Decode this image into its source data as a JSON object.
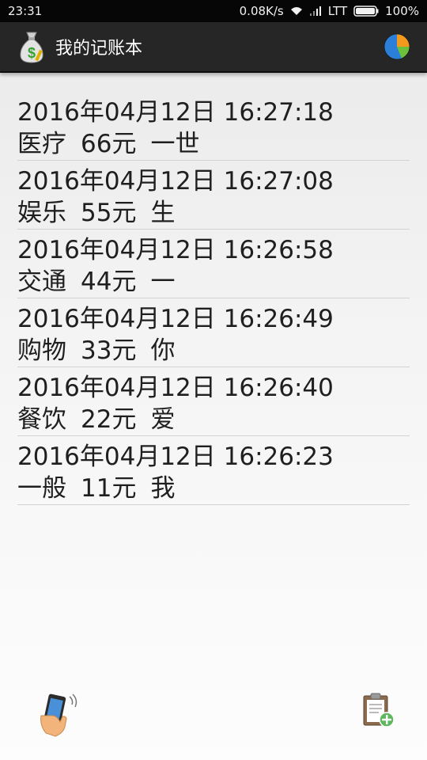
{
  "status_bar": {
    "time": "23:31",
    "speed": "0.08K/s",
    "network": "LTT",
    "battery": "100%"
  },
  "app_bar": {
    "title": "我的记账本",
    "app_icon": "money-bag-icon",
    "chart_icon": "pie-chart-icon"
  },
  "records": [
    {
      "datetime": "2016年04月12日 16:27:18",
      "category": "医疗",
      "amount": "66元",
      "note": "一世"
    },
    {
      "datetime": "2016年04月12日 16:27:08",
      "category": "娱乐",
      "amount": "55元",
      "note": "生"
    },
    {
      "datetime": "2016年04月12日 16:26:58",
      "category": "交通",
      "amount": "44元",
      "note": "一"
    },
    {
      "datetime": "2016年04月12日 16:26:49",
      "category": "购物",
      "amount": "33元",
      "note": "你"
    },
    {
      "datetime": "2016年04月12日 16:26:40",
      "category": "餐饮",
      "amount": "22元",
      "note": "爱"
    },
    {
      "datetime": "2016年04月12日 16:26:23",
      "category": "一般",
      "amount": "11元",
      "note": "我"
    }
  ],
  "bottom": {
    "left_icon": "phone-shake-icon",
    "right_icon": "clipboard-add-icon"
  },
  "colors": {
    "action_bar": "#262626",
    "status_bar": "#060606",
    "pie_blue": "#2b7fd8",
    "pie_orange": "#f39a1e",
    "pie_green": "#6bbf3a",
    "add_green": "#5cb85c"
  }
}
